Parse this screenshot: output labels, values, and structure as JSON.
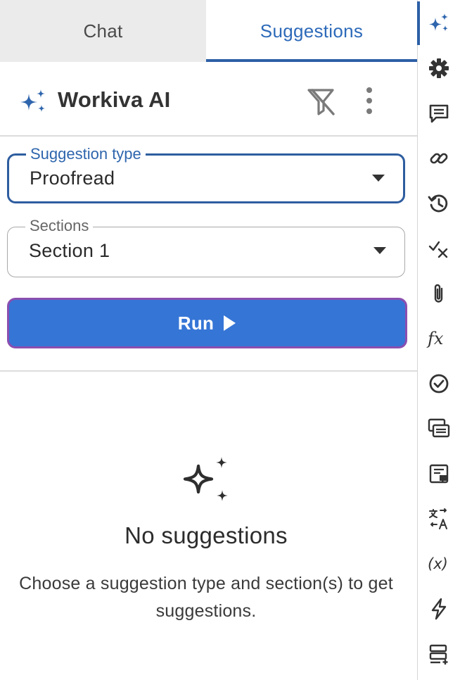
{
  "tabs": {
    "chat": "Chat",
    "suggestions": "Suggestions"
  },
  "header": {
    "title": "Workiva AI"
  },
  "form": {
    "suggestion_type": {
      "label": "Suggestion type",
      "value": "Proofread"
    },
    "sections": {
      "label": "Sections",
      "value": "Section 1"
    },
    "run_label": "Run"
  },
  "empty_state": {
    "title": "No suggestions",
    "description": "Choose a suggestion type and section(s) to get suggestions."
  },
  "rail": {
    "formula_label": "fx",
    "variable_label": "(x)"
  },
  "colors": {
    "accent": "#2d5fa6",
    "run_button": "#3575d6",
    "focus_outline": "#8a4fb0"
  }
}
